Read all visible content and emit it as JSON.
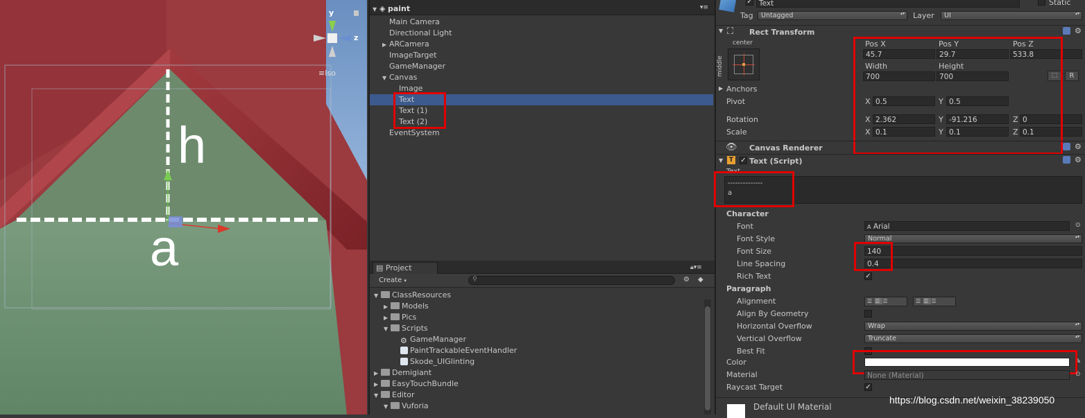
{
  "scene": {
    "gizmo": {
      "y_label": "y",
      "z_label": "z",
      "view_mode": "Iso"
    },
    "label_h": "h",
    "label_a": "a"
  },
  "hierarchy": {
    "title": "paint",
    "items": [
      {
        "label": "Main Camera",
        "arrow": ""
      },
      {
        "label": "Directional Light",
        "arrow": ""
      },
      {
        "label": "ARCamera",
        "arrow": "▶"
      },
      {
        "label": "ImageTarget",
        "arrow": ""
      },
      {
        "label": "GameManager",
        "arrow": ""
      },
      {
        "label": "Canvas",
        "arrow": "▼"
      },
      {
        "label": "Image",
        "arrow": ""
      },
      {
        "label": "Text",
        "arrow": ""
      },
      {
        "label": "Text (1)",
        "arrow": ""
      },
      {
        "label": "Text (2)",
        "arrow": ""
      },
      {
        "label": "EventSystem",
        "arrow": ""
      }
    ]
  },
  "project": {
    "tab": "Project",
    "create": "Create",
    "items": [
      {
        "label": "ClassResources",
        "arrow": "▼"
      },
      {
        "label": "Models",
        "arrow": "▶"
      },
      {
        "label": "Pics",
        "arrow": "▶"
      },
      {
        "label": "Scripts",
        "arrow": "▼"
      },
      {
        "label": "GameManager",
        "arrow": ""
      },
      {
        "label": "PaintTrackableEventHandler",
        "arrow": ""
      },
      {
        "label": "Skode_UIGlinting",
        "arrow": ""
      },
      {
        "label": "Demigiant",
        "arrow": "▶"
      },
      {
        "label": "EasyTouchBundle",
        "arrow": "▶"
      },
      {
        "label": "Editor",
        "arrow": "▼"
      },
      {
        "label": "Vuforia",
        "arrow": "▼"
      }
    ]
  },
  "inspector": {
    "object_name": "Text",
    "static_label": "Static",
    "tag_label": "Tag",
    "tag_value": "Untagged",
    "layer_label": "Layer",
    "layer_value": "UI",
    "rect": {
      "title": "Rect Transform",
      "anchor_h": "center",
      "anchor_v": "middle",
      "posx_label": "Pos X",
      "posy_label": "Pos Y",
      "posz_label": "Pos Z",
      "posx": "45.7",
      "posy": "29.7",
      "posz": "533.8",
      "width_label": "Width",
      "height_label": "Height",
      "width": "700",
      "height": "700",
      "r_button": "R",
      "anchors_label": "Anchors",
      "pivot_label": "Pivot",
      "pivot_x": "0.5",
      "pivot_y": "0.5",
      "rotation_label": "Rotation",
      "rot_x": "2.362",
      "rot_y": "-91.216",
      "rot_z": "0",
      "scale_label": "Scale",
      "scale_x": "0.1",
      "scale_y": "0.1",
      "scale_z": "0.1",
      "x": "X",
      "y": "Y",
      "z": "Z"
    },
    "canvas_renderer": {
      "title": "Canvas Renderer"
    },
    "text_script": {
      "title": "Text (Script)",
      "text_label": "Text",
      "text_line1": "--------------",
      "text_line2": "a",
      "character_label": "Character",
      "font_label": "Font",
      "font_value": "Arial",
      "font_style_label": "Font Style",
      "font_style_value": "Normal",
      "font_size_label": "Font Size",
      "font_size_value": "140",
      "line_spacing_label": "Line Spacing",
      "line_spacing_value": "0.4",
      "rich_text_label": "Rich Text",
      "paragraph_label": "Paragraph",
      "alignment_label": "Alignment",
      "align_by_geometry_label": "Align By Geometry",
      "horizontal_overflow_label": "Horizontal Overflow",
      "horizontal_overflow_value": "Wrap",
      "vertical_overflow_label": "Vertical Overflow",
      "vertical_overflow_value": "Truncate",
      "best_fit_label": "Best Fit",
      "color_label": "Color",
      "color_value": "#ffffff",
      "material_label": "Material",
      "material_value": "None (Material)",
      "raycast_label": "Raycast Target"
    },
    "default_material": "Default UI Material"
  },
  "watermark": "https://blog.csdn.net/weixin_38239050",
  "colors": {
    "highlight": "#e00000",
    "selection": "#3d5a8e",
    "panel": "#383838"
  }
}
